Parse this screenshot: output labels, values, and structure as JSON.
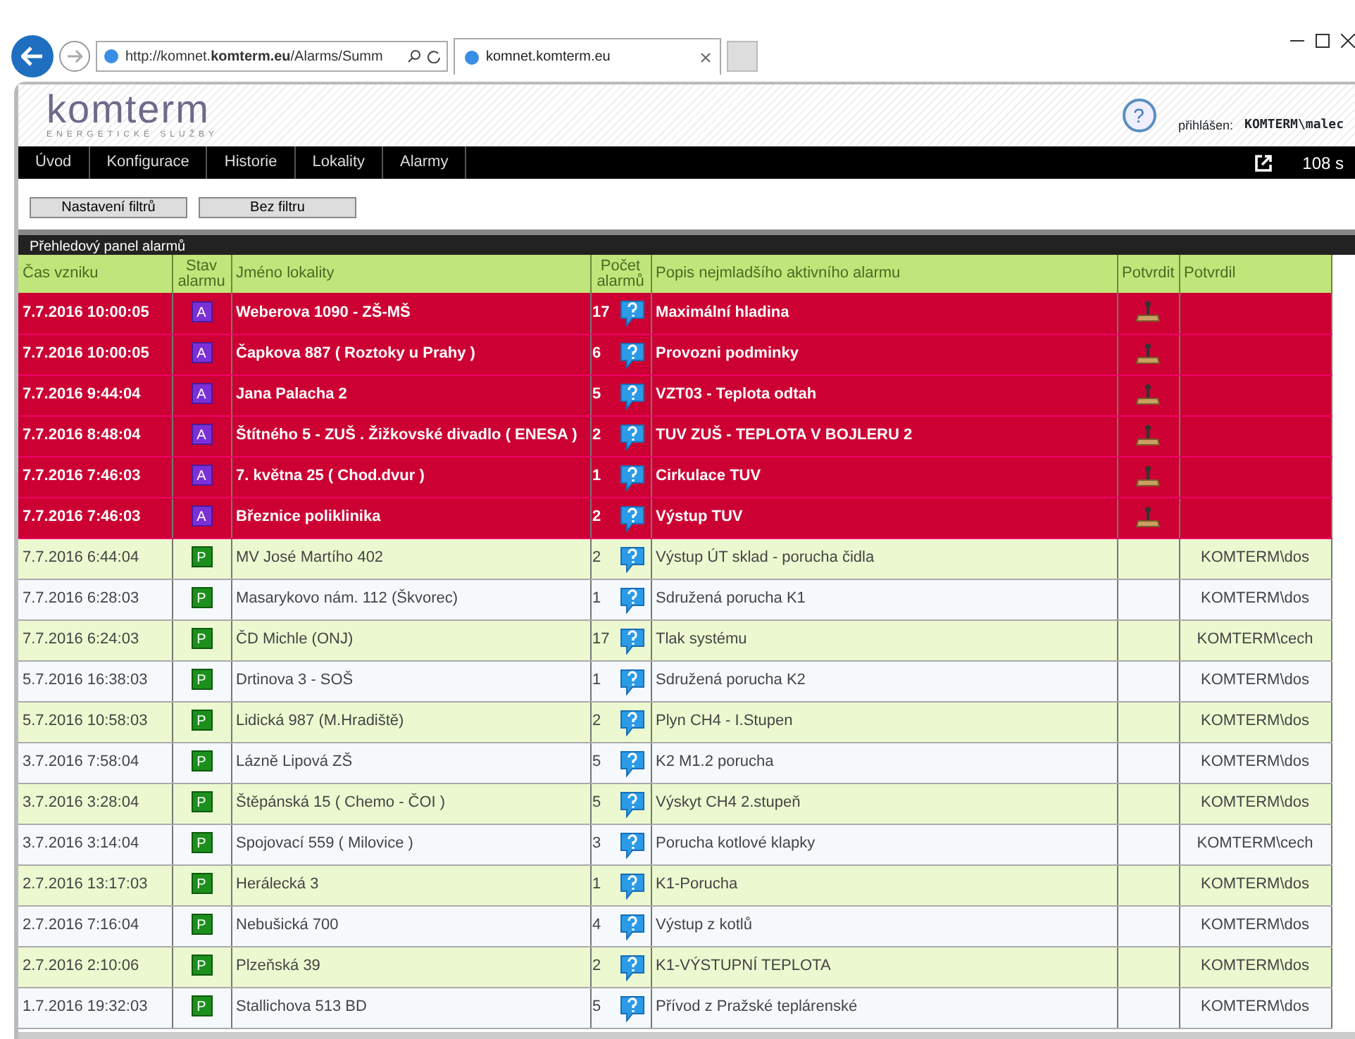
{
  "browser": {
    "address": "http://komnet.**komterm.eu**/Alarms/Summ",
    "tab": "komnet.komterm.eu"
  },
  "header": {
    "logo": "komterm",
    "tagline": "ENERGETICKÉ SLUŽBY",
    "help": "?",
    "login_label": "přihlášen:",
    "user": "KOMTERM\\malec"
  },
  "nav": {
    "items": [
      "Úvod",
      "Konfigurace",
      "Historie",
      "Lokality",
      "Alarmy"
    ],
    "timer": "108 s"
  },
  "filters": [
    "Nastavení filtrů",
    "Bez filtru"
  ],
  "panel": {
    "title": "Přehledový panel alarmů",
    "columns": [
      "Čas vzniku",
      "Stav alarmu",
      "Jméno lokality",
      "Počet alarmů",
      "Popis nejmladšího aktivního alarmu",
      "Potvrdit",
      "Potvrdil"
    ],
    "rows": [
      {
        "kind": "active",
        "time": "7.7.2016 10:00:05",
        "state": "A",
        "location": "Weberova 1090 - ZŠ-MŠ",
        "count": "17",
        "description": "Maximální hladina",
        "confirmed_by": ""
      },
      {
        "kind": "active",
        "time": "7.7.2016 10:00:05",
        "state": "A",
        "location": "Čapkova 887 ( Roztoky u Prahy )",
        "count": "6",
        "description": "Provozni podminky",
        "confirmed_by": ""
      },
      {
        "kind": "active",
        "time": "7.7.2016 9:44:04",
        "state": "A",
        "location": "Jana Palacha 2",
        "count": "5",
        "description": "VZT03 - Teplota odtah",
        "confirmed_by": ""
      },
      {
        "kind": "active",
        "time": "7.7.2016 8:48:04",
        "state": "A",
        "location": "Štítného 5 - ZUŠ . Žižkovské divadlo ( ENESA )",
        "count": "2",
        "description": "TUV ZUŠ - TEPLOTA V BOJLERU 2",
        "confirmed_by": ""
      },
      {
        "kind": "active",
        "time": "7.7.2016 7:46:03",
        "state": "A",
        "location": "7. května 25 ( Chod.dvur )",
        "count": "1",
        "description": "Cirkulace TUV",
        "confirmed_by": ""
      },
      {
        "kind": "active",
        "time": "7.7.2016 7:46:03",
        "state": "A",
        "location": "Březnice poliklinika",
        "count": "2",
        "description": "Výstup TUV",
        "confirmed_by": ""
      },
      {
        "kind": "acknowledged",
        "time": "7.7.2016 6:44:04",
        "state": "P",
        "location": "MV José Martího 402",
        "count": "2",
        "description": "Výstup ÚT sklad - porucha čidla",
        "confirmed_by": "KOMTERM\\dos"
      },
      {
        "kind": "acknowledged",
        "time": "7.7.2016 6:28:03",
        "state": "P",
        "location": "Masarykovo nám. 112 (Škvorec)",
        "count": "1",
        "description": "Sdružená porucha K1",
        "confirmed_by": "KOMTERM\\dos"
      },
      {
        "kind": "acknowledged",
        "time": "7.7.2016 6:24:03",
        "state": "P",
        "location": "ČD Michle (ONJ)",
        "count": "17",
        "description": "Tlak systému",
        "confirmed_by": "KOMTERM\\cech"
      },
      {
        "kind": "acknowledged",
        "time": "5.7.2016 16:38:03",
        "state": "P",
        "location": "Drtinova 3 - SOŠ",
        "count": "1",
        "description": "Sdružená porucha K2",
        "confirmed_by": "KOMTERM\\dos"
      },
      {
        "kind": "acknowledged",
        "time": "5.7.2016 10:58:03",
        "state": "P",
        "location": "Lidická 987 (M.Hradiště)",
        "count": "2",
        "description": "Plyn CH4 - I.Stupen",
        "confirmed_by": "KOMTERM\\dos"
      },
      {
        "kind": "acknowledged",
        "time": "3.7.2016 7:58:04",
        "state": "P",
        "location": "Lázně Lipová ZŠ",
        "count": "5",
        "description": "K2 M1.2 porucha",
        "confirmed_by": "KOMTERM\\dos"
      },
      {
        "kind": "acknowledged",
        "time": "3.7.2016 3:28:04",
        "state": "P",
        "location": "Štěpánská 15 ( Chemo - ČOI )",
        "count": "5",
        "description": "Výskyt CH4 2.stupeň",
        "confirmed_by": "KOMTERM\\dos"
      },
      {
        "kind": "acknowledged",
        "time": "3.7.2016 3:14:04",
        "state": "P",
        "location": "Spojovací 559 ( Milovice )",
        "count": "3",
        "description": "Porucha kotlové klapky",
        "confirmed_by": "KOMTERM\\cech"
      },
      {
        "kind": "acknowledged",
        "time": "2.7.2016 13:17:03",
        "state": "P",
        "location": "Herálecká 3",
        "count": "1",
        "description": "K1-Porucha",
        "confirmed_by": "KOMTERM\\dos"
      },
      {
        "kind": "acknowledged",
        "time": "2.7.2016 7:16:04",
        "state": "P",
        "location": "Nebušická 700",
        "count": "4",
        "description": "Výstup z kotlů",
        "confirmed_by": "KOMTERM\\dos"
      },
      {
        "kind": "acknowledged",
        "time": "2.7.2016 2:10:06",
        "state": "P",
        "location": "Plzeňská 39",
        "count": "2",
        "description": "K1-VÝSTUPNÍ TEPLOTA",
        "confirmed_by": "KOMTERM\\dos"
      },
      {
        "kind": "acknowledged",
        "time": "1.7.2016 19:32:03",
        "state": "P",
        "location": "Stallichova 513 BD",
        "count": "5",
        "description": "Přívod z Pražské teplárenské",
        "confirmed_by": "KOMTERM\\dos"
      }
    ]
  }
}
